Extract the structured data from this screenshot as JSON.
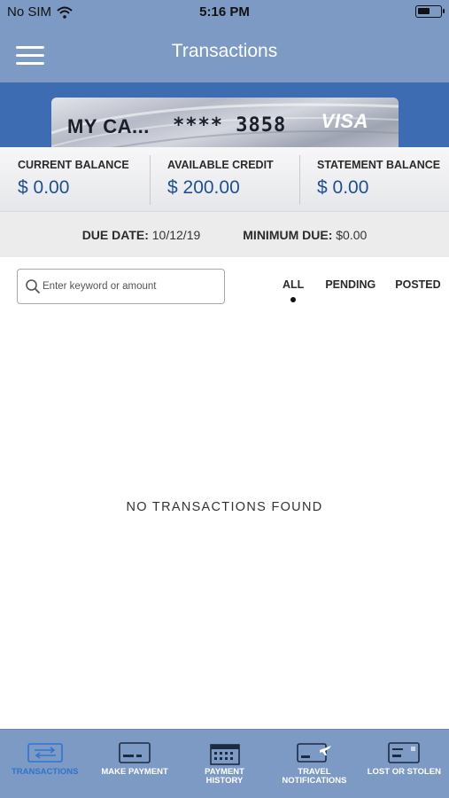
{
  "status_bar": {
    "carrier": "No SIM",
    "time": "5:16 PM",
    "battery_level": 0.55
  },
  "header": {
    "title": "Transactions"
  },
  "card": {
    "name": "MY CA...",
    "number": "**** 3858",
    "brand": "VISA"
  },
  "balances": [
    {
      "label": "CURRENT BALANCE",
      "value": "$ 0.00"
    },
    {
      "label": "AVAILABLE CREDIT",
      "value": "$ 200.00"
    },
    {
      "label": "STATEMENT BALANCE",
      "value": "$ 0.00"
    }
  ],
  "due": {
    "due_date_label": "DUE DATE:",
    "due_date_value": "10/12/19",
    "min_due_label": "MINIMUM DUE:",
    "min_due_value": "$0.00"
  },
  "search": {
    "placeholder": "Enter keyword or amount",
    "value": ""
  },
  "filters": [
    {
      "label": "ALL",
      "selected": true
    },
    {
      "label": "PENDING",
      "selected": false
    },
    {
      "label": "POSTED",
      "selected": false
    }
  ],
  "empty_message": "NO TRANSACTIONS FOUND",
  "tabs": [
    {
      "label": "TRANSACTIONS",
      "icon": "transactions-icon",
      "active": true
    },
    {
      "label": "MAKE PAYMENT",
      "icon": "card-icon",
      "active": false
    },
    {
      "label": "PAYMENT HISTORY",
      "icon": "calendar-icon",
      "active": false
    },
    {
      "label": "TRAVEL NOTIFICATIONS",
      "icon": "airplane-card-icon",
      "active": false
    },
    {
      "label": "LOST OR STOLEN",
      "icon": "card-alert-icon",
      "active": false
    }
  ],
  "colors": {
    "header": "#7c9ac4",
    "card_band": "#3e6cb3",
    "balance_value": "#1e4f95",
    "active_tab": "#2f74d0"
  }
}
